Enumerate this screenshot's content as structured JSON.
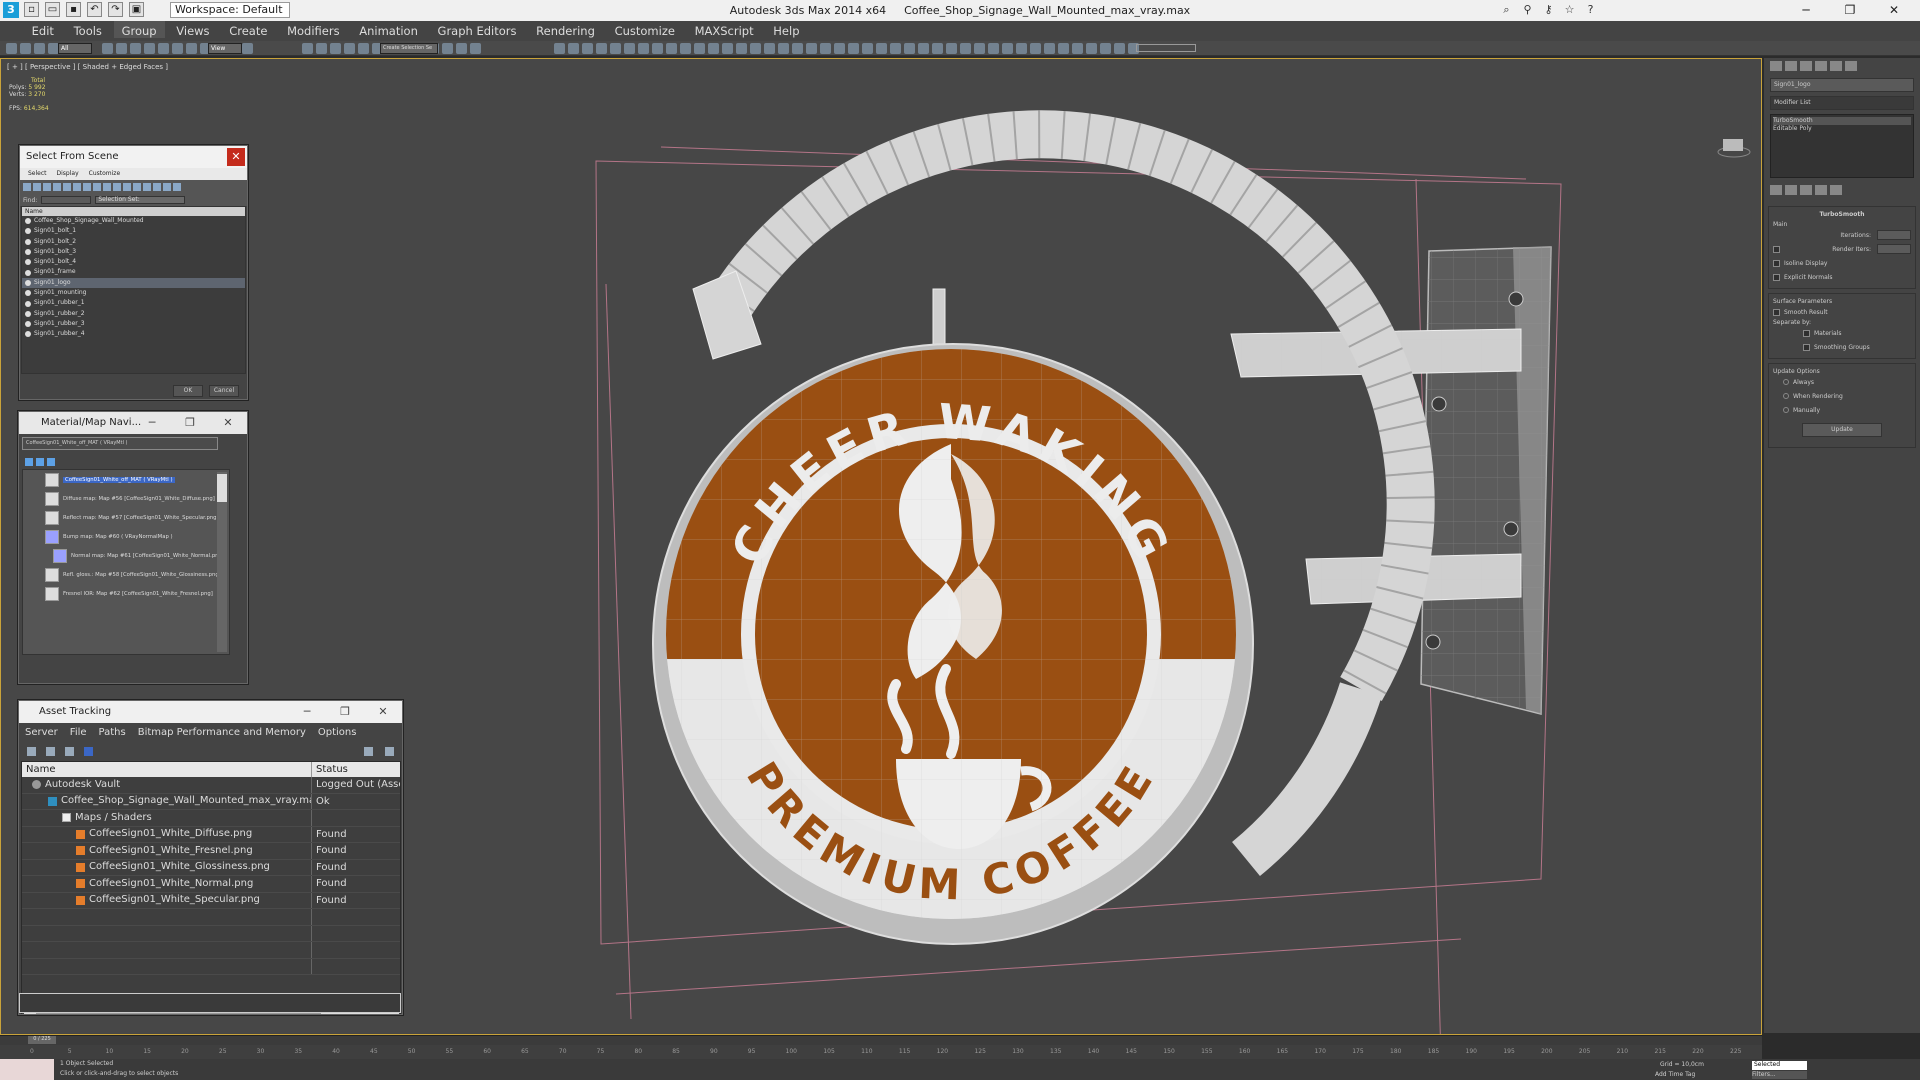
{
  "window": {
    "app_title": "Autodesk 3ds Max  2014 x64",
    "file_title": "Coffee_Shop_Signage_Wall_Mounted_max_vray.max",
    "workspace": "Workspace: Default",
    "controls": {
      "minimize": "─",
      "maximize": "❐",
      "close": "✕"
    }
  },
  "menu": [
    "Edit",
    "Tools",
    "Group",
    "Views",
    "Create",
    "Modifiers",
    "Animation",
    "Graph Editors",
    "Rendering",
    "Customize",
    "MAXScript",
    "Help"
  ],
  "toolbar": {
    "filter": "All",
    "ref_coord": "View",
    "selection_set": "Create Selection Se"
  },
  "viewport": {
    "label": "[ + ] [ Perspective ] [ Shaded + Edged Faces ]",
    "stats": {
      "total_label": "Total",
      "polys_label": "Polys:",
      "polys": "5 992",
      "verts_label": "Verts:",
      "verts": "3 270",
      "fps_label": "FPS:",
      "fps": "614,364"
    },
    "sign": {
      "top_text": "CHEER WAKING",
      "bottom_text": "PREMIUM COFFEE",
      "brand_color": "#9a4f12",
      "panel_color": "#e9e9e9"
    }
  },
  "select_from_scene": {
    "title": "Select From Scene",
    "close": "✕",
    "menu": [
      "Select",
      "Display",
      "Customize"
    ],
    "find_label": "Find:",
    "selection_set_label": "Selection Set:",
    "column_name": "Name",
    "items": [
      "Coffee_Shop_Signage_Wall_Mounted",
      "Sign01_bolt_1",
      "Sign01_bolt_2",
      "Sign01_bolt_3",
      "Sign01_bolt_4",
      "Sign01_frame",
      "Sign01_logo",
      "Sign01_mounting",
      "Sign01_rubber_1",
      "Sign01_rubber_2",
      "Sign01_rubber_3",
      "Sign01_rubber_4"
    ],
    "selected_index": 6,
    "ok": "OK",
    "cancel": "Cancel"
  },
  "material_navigator": {
    "title": "Material/Map Navi...",
    "current": "CoffeeSign01_White_off_MAT  ( VRayMtl )",
    "tree": [
      {
        "text": "CoffeeSign01_White_off_MAT  ( VRayMtl )"
      },
      {
        "text": "Diffuse map: Map #56 [CoffeeSign01_White_Diffuse.png]"
      },
      {
        "text": "Reflect map: Map #57 [CoffeeSign01_White_Specular.png]"
      },
      {
        "text": "Bump map: Map #60  ( VRayNormalMap )"
      },
      {
        "text": "Normal map: Map #61 [CoffeeSign01_White_Normal.png]"
      },
      {
        "text": "Refl. gloss.: Map #58 [CoffeeSign01_White_Glossiness.png]"
      },
      {
        "text": "Fresnel IOR: Map #62 [CoffeeSign01_White_Fresnel.png]"
      }
    ]
  },
  "asset_tracking": {
    "title": "Asset Tracking",
    "menu": [
      "Server",
      "File",
      "Paths",
      "Bitmap Performance and Memory",
      "Options"
    ],
    "columns": {
      "name": "Name",
      "status": "Status"
    },
    "rows": [
      {
        "name": "Autodesk Vault",
        "status": "Logged Out (Asse...",
        "icon": "vault"
      },
      {
        "name": "Coffee_Shop_Signage_Wall_Mounted_max_vray.max",
        "status": "Ok",
        "icon": "max"
      },
      {
        "name": "Maps / Shaders",
        "status": "",
        "icon": "folder"
      },
      {
        "name": "CoffeeSign01_White_Diffuse.png",
        "status": "Found",
        "icon": "png"
      },
      {
        "name": "CoffeeSign01_White_Fresnel.png",
        "status": "Found",
        "icon": "png"
      },
      {
        "name": "CoffeeSign01_White_Glossiness.png",
        "status": "Found",
        "icon": "png"
      },
      {
        "name": "CoffeeSign01_White_Normal.png",
        "status": "Found",
        "icon": "png"
      },
      {
        "name": "CoffeeSign01_White_Specular.png",
        "status": "Found",
        "icon": "png"
      }
    ]
  },
  "command_panel": {
    "object_name": "Sign01_logo",
    "modifier_list": "Modifier List",
    "stack": [
      "TurboSmooth",
      "Editable Poly"
    ],
    "rollout_title": "TurboSmooth",
    "main_label": "Main",
    "iterations_label": "Iterations:",
    "render_iters_label": "Render Iters:",
    "isoline_label": "Isoline Display",
    "explicit_normals_label": "Explicit Normals",
    "surface_label": "Surface Parameters",
    "smooth_result_label": "Smooth Result",
    "separate_label": "Separate by:",
    "materials_label": "Materials",
    "smoothing_groups_label": "Smoothing Groups",
    "update_options_label": "Update Options",
    "always_label": "Always",
    "when_rendering_label": "When Rendering",
    "manually_label": "Manually",
    "update_button": "Update"
  },
  "timeline": {
    "frame": "0 / 225",
    "ticks": [
      "0",
      "5",
      "10",
      "15",
      "20",
      "25",
      "30",
      "35",
      "40",
      "45",
      "50",
      "55",
      "60",
      "65",
      "70",
      "75",
      "80",
      "85",
      "90",
      "95",
      "100",
      "105",
      "110",
      "115",
      "120",
      "125",
      "130",
      "135",
      "140",
      "145",
      "150",
      "155",
      "160",
      "165",
      "170",
      "175",
      "180",
      "185",
      "190",
      "195",
      "200",
      "205",
      "210",
      "215",
      "220",
      "225"
    ]
  },
  "status": {
    "selected": "1 Object Selected",
    "prompt": "Click or click-and-drag to select objects",
    "grid": "Grid = 10,0cm",
    "add_time_tag": "Add Time Tag",
    "key_filter": "Selected",
    "filters": "Filters..."
  }
}
